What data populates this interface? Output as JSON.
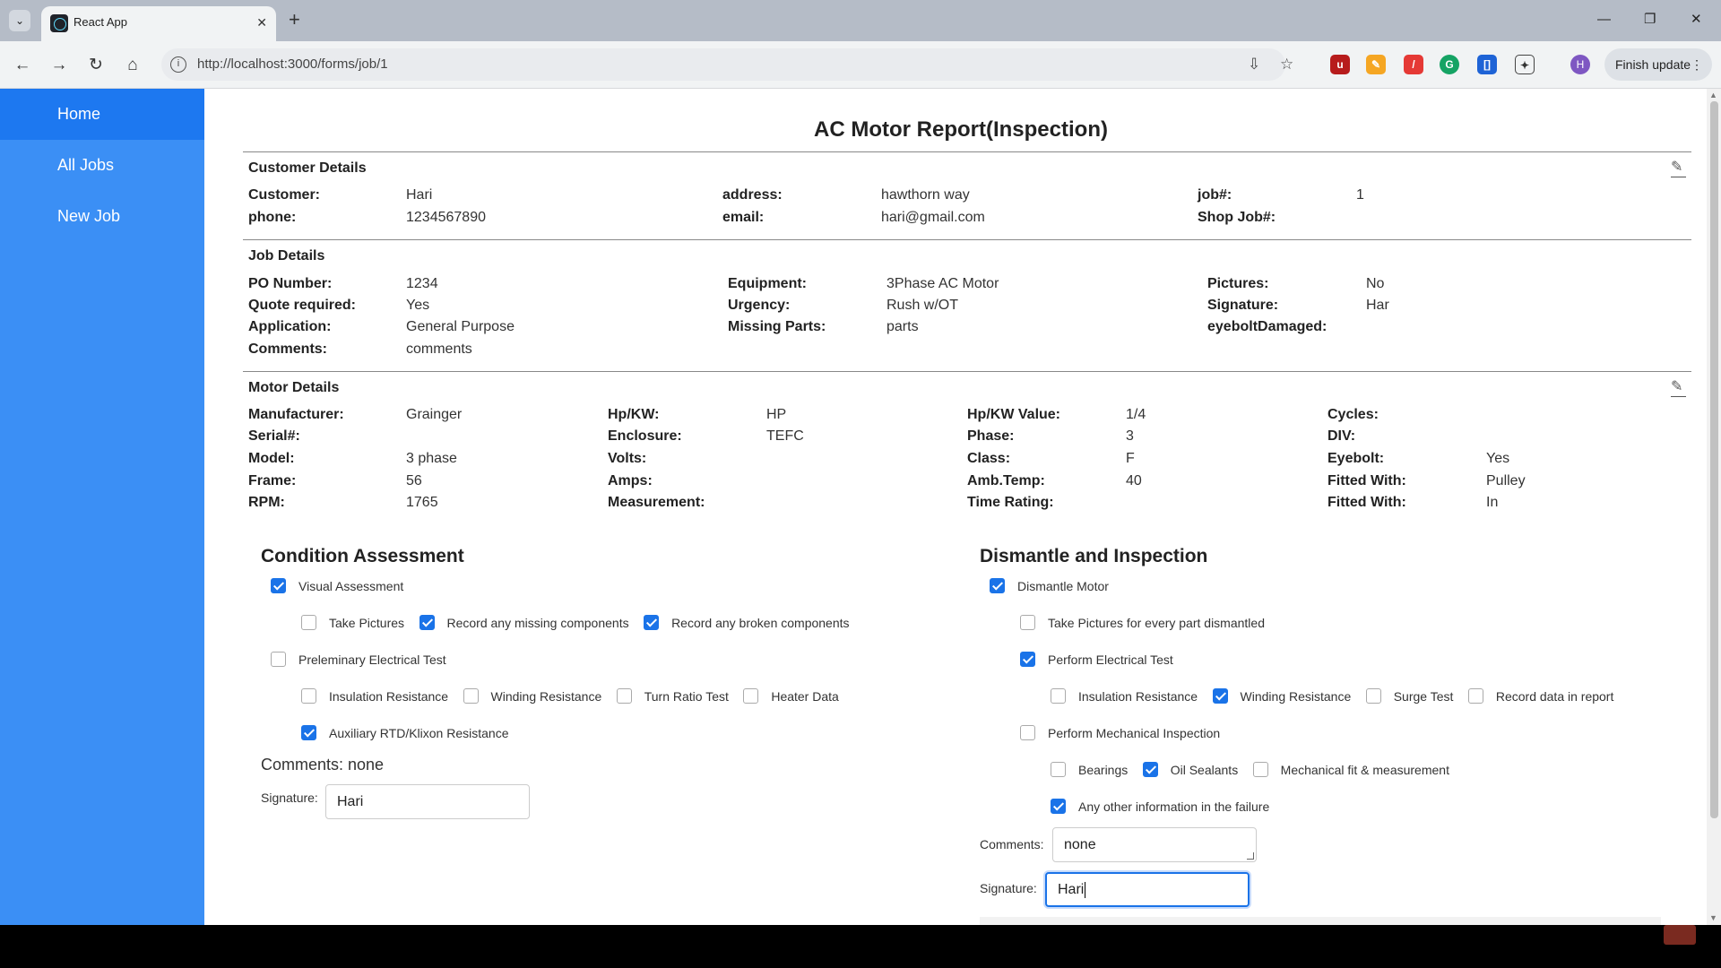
{
  "browser": {
    "tab_title": "React App",
    "url_host": "http://localhost:3000/forms/job/1",
    "finish_update": "Finish update",
    "profile_initial": "H"
  },
  "sidebar": {
    "items": [
      {
        "label": "Home"
      },
      {
        "label": "All Jobs"
      },
      {
        "label": "New Job"
      }
    ]
  },
  "page": {
    "title": "AC Motor Report(Inspection)"
  },
  "customer": {
    "heading": "Customer Details",
    "customer_label": "Customer:",
    "customer": "Hari",
    "address_label": "address:",
    "address": "hawthorn way",
    "job_label": "job#:",
    "job": "1",
    "phone_label": "phone:",
    "phone": "1234567890",
    "email_label": "email:",
    "email": "hari@gmail.com",
    "shopjob_label": "Shop Job#:"
  },
  "job": {
    "heading": "Job Details",
    "po_label": "PO Number:",
    "po": "1234",
    "quote_label": "Quote required:",
    "quote": "Yes",
    "application_label": "Application:",
    "application": "General Purpose",
    "comments_label": "Comments:",
    "comments": "comments",
    "equipment_label": "Equipment:",
    "equipment": "3Phase AC Motor",
    "urgency_label": "Urgency:",
    "urgency": "Rush w/OT",
    "missing_label": "Missing Parts:",
    "missing": "parts",
    "pictures_label": "Pictures:",
    "pictures": "No",
    "signature_label": "Signature:",
    "signature": "Har",
    "eyebolt_label": "eyeboltDamaged:"
  },
  "motor": {
    "heading": "Motor Details",
    "manufacturer_label": "Manufacturer:",
    "manufacturer": "Grainger",
    "serial_label": "Serial#:",
    "model_label": "Model:",
    "model": "3 phase",
    "frame_label": "Frame:",
    "frame": "56",
    "rpm_label": "RPM:",
    "rpm": "1765",
    "hpkw_label": "Hp/KW:",
    "hpkw": "HP",
    "enclosure_label": "Enclosure:",
    "enclosure": "TEFC",
    "volts_label": "Volts:",
    "amps_label": "Amps:",
    "measurement_label": "Measurement:",
    "hpkwval_label": "Hp/KW Value:",
    "hpkwval": "1/4",
    "phase_label": "Phase:",
    "phase": "3",
    "class_label": "Class:",
    "class": "F",
    "ambtemp_label": "Amb.Temp:",
    "ambtemp": "40",
    "timerating_label": "Time Rating:",
    "cycles_label": "Cycles:",
    "div_label": "DIV:",
    "eyebolt_label": "Eyebolt:",
    "eyebolt": "Yes",
    "fitted1_label": "Fitted With:",
    "fitted1": "Pulley",
    "fitted2_label": "Fitted With:",
    "fitted2": "In"
  },
  "condition": {
    "title": "Condition Assessment",
    "visual": "Visual Assessment",
    "take_pictures": "Take Pictures",
    "record_missing": "Record any missing components",
    "record_broken": "Record any broken components",
    "prelim": "Preleminary Electrical Test",
    "insulation": "Insulation Resistance",
    "winding": "Winding Resistance",
    "turn_ratio": "Turn Ratio Test",
    "heater": "Heater Data",
    "auxiliary": "Auxiliary RTD/Klixon Resistance",
    "comments_line": "Comments: none",
    "signature_label": "Signature:",
    "signature_value": "Hari"
  },
  "dismantle": {
    "title": "Dismantle and Inspection",
    "dismantle_motor": "Dismantle Motor",
    "take_pictures": "Take Pictures for every part dismantled",
    "perform_electrical": "Perform Electrical Test",
    "insulation": "Insulation Resistance",
    "winding": "Winding Resistance",
    "surge": "Surge Test",
    "record_data": "Record data in report",
    "perform_mechanical": "Perform Mechanical Inspection",
    "bearings": "Bearings",
    "oil_sealants": "Oil Sealants",
    "mechanical_fit": "Mechanical fit & measurement",
    "any_other": "Any other information in the failure",
    "comments_label": "Comments:",
    "comments_value": "none",
    "signature_label": "Signature:",
    "signature_value": "Hari"
  },
  "colors": {
    "sidebar": "#3b8ff5",
    "sidebar_active": "#1d78f0",
    "checkbox_on": "#1a73e8"
  }
}
